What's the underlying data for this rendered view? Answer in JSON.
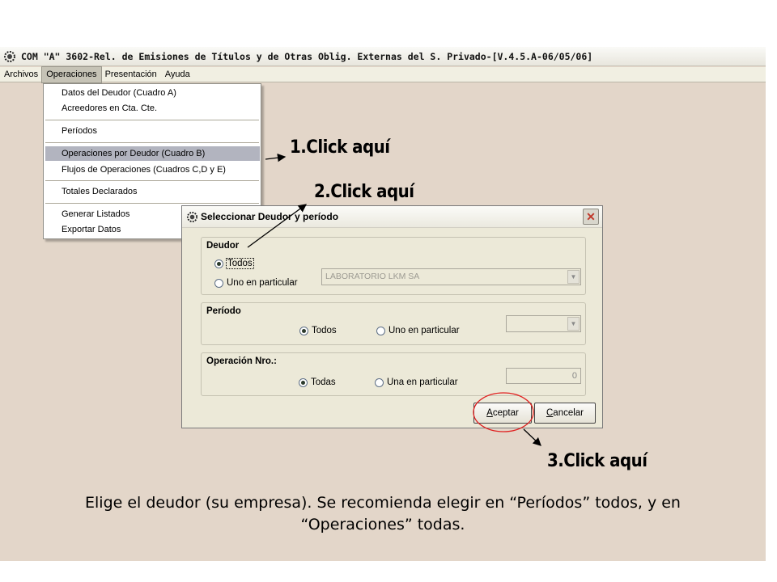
{
  "window": {
    "title": "COM \"A\" 3602-Rel. de Emisiones de Títulos y de Otras Oblig. Externas del S. Privado-[V.4.5.A-06/05/06]",
    "icon": "app-gear-icon"
  },
  "menubar": {
    "items": [
      "Archivos",
      "Operaciones",
      "Presentación",
      "Ayuda"
    ],
    "active": "Operaciones"
  },
  "dropdown": {
    "items": [
      "Datos del Deudor (Cuadro A)",
      "Acreedores en Cta. Cte.",
      "Períodos",
      "Operaciones por Deudor (Cuadro B)",
      "Flujos de Operaciones (Cuadros C,D y E)",
      "Totales Declarados",
      "Generar Listados",
      "Exportar Datos"
    ],
    "highlighted": "Operaciones por Deudor (Cuadro B)"
  },
  "dialog": {
    "title": "Seleccionar Deudor y período",
    "deudor": {
      "label": "Deudor",
      "opt_all": "Todos",
      "opt_one": "Uno en particular",
      "combo_value": "LABORATORIO LKM SA"
    },
    "periodo": {
      "label": "Período",
      "opt_all": "Todos",
      "opt_one": "Uno en particular",
      "combo_value": ""
    },
    "operacion": {
      "label": "Operación Nro.:",
      "opt_all": "Todas",
      "opt_one": "Una en particular",
      "field_value": "0"
    },
    "buttons": {
      "accept_first": "A",
      "accept_rest": "ceptar",
      "cancel_first": "C",
      "cancel_rest": "ancelar"
    }
  },
  "annotations": {
    "step1": "1.Click aquí",
    "step2": "2.Click aquí",
    "step3": "3.Click aquí",
    "caption_line1": "Elige el deudor (su empresa). Se recomienda elegir en “Períodos” todos, y en",
    "caption_line2": "“Operaciones” todas."
  },
  "colors": {
    "background": "#e3d6c9",
    "highlight_circle": "#e02020",
    "menu_highlight": "#b2b4bf"
  }
}
